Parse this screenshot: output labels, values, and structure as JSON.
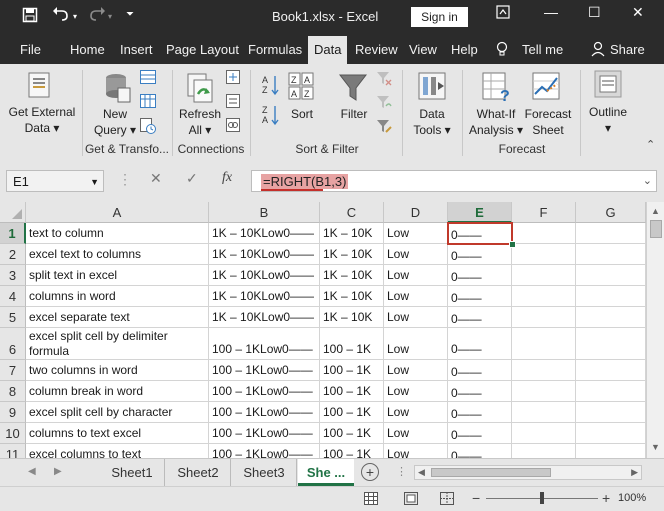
{
  "titlebar": {
    "title": "Book1.xlsx - Excel",
    "signin": "Sign in",
    "save_icon": "save-icon",
    "undo_icon": "undo-icon",
    "redo_icon": "redo-icon",
    "minimize": "—",
    "restore": "☐",
    "close": "✕",
    "ribbon_options": "▢"
  },
  "menu": {
    "items": [
      "File",
      "Home",
      "Insert",
      "Page Layout",
      "Formulas",
      "Data",
      "Review",
      "View",
      "Help",
      "Tell me",
      "Share"
    ],
    "active": "Data"
  },
  "ribbon": {
    "get_external": "Get External",
    "data_dd": "Data ▾",
    "new": "New",
    "query_dd": "Query ▾",
    "refresh": "Refresh",
    "all_dd": "All ▾",
    "sort": "Sort",
    "filter": "Filter",
    "data_label": "Data",
    "tools_dd": "Tools ▾",
    "whatif": "What-If",
    "analysis_dd": "Analysis ▾",
    "forecast": "Forecast",
    "sheet": "Sheet",
    "outline": "Outline",
    "outline_dd": "▾",
    "groups": {
      "get_transform": "Get & Transfo...",
      "connections": "Connections",
      "sort_filter": "Sort & Filter",
      "forecast": "Forecast"
    }
  },
  "formula_bar": {
    "name_box": "E1",
    "cancel": "✕",
    "enter": "✓",
    "fx": "fx",
    "formula": "=RIGHT(B1,3)"
  },
  "grid": {
    "columns": [
      "A",
      "B",
      "C",
      "D",
      "E",
      "F",
      "G"
    ],
    "selected_column": "E",
    "rows": [
      {
        "n": "1",
        "a": "text to column",
        "b": "1K – 10KLow0——",
        "c": "1K – 10K",
        "d": "Low",
        "e": "0——"
      },
      {
        "n": "2",
        "a": "excel text to columns",
        "b": "1K – 10KLow0——",
        "c": "1K – 10K",
        "d": "Low",
        "e": "0——"
      },
      {
        "n": "3",
        "a": "split text in excel",
        "b": "1K – 10KLow0——",
        "c": "1K – 10K",
        "d": "Low",
        "e": "0——"
      },
      {
        "n": "4",
        "a": "columns in word",
        "b": "1K – 10KLow0——",
        "c": "1K – 10K",
        "d": "Low",
        "e": "0——"
      },
      {
        "n": "5",
        "a": "excel separate text",
        "b": "1K – 10KLow0——",
        "c": "1K – 10K",
        "d": "Low",
        "e": "0——"
      },
      {
        "n": "6",
        "a": "excel split cell by delimiter formula",
        "b": "100 – 1KLow0——",
        "c": "100 – 1K",
        "d": "Low",
        "e": "0——"
      },
      {
        "n": "7",
        "a": "two columns in word",
        "b": "100 – 1KLow0——",
        "c": "100 – 1K",
        "d": "Low",
        "e": "0——"
      },
      {
        "n": "8",
        "a": "column break in word",
        "b": "100 – 1KLow0——",
        "c": "100 – 1K",
        "d": "Low",
        "e": "0——"
      },
      {
        "n": "9",
        "a": "excel split cell by character",
        "b": "100 – 1KLow0——",
        "c": "100 – 1K",
        "d": "Low",
        "e": "0——"
      },
      {
        "n": "10",
        "a": "columns to text excel",
        "b": "100 – 1KLow0——",
        "c": "100 – 1K",
        "d": "Low",
        "e": "0——"
      },
      {
        "n": "11",
        "a": "excel columns to text",
        "b": "100 – 1KLow0——",
        "c": "100 – 1K",
        "d": "Low",
        "e": "0——"
      }
    ]
  },
  "sheets": {
    "tabs": [
      "Sheet1",
      "Sheet2",
      "Sheet3",
      "She ..."
    ],
    "active": "She ...",
    "add": "+"
  },
  "status": {
    "zoom": "100%",
    "zoom_level": 0.5,
    "minus": "−",
    "plus": "+"
  },
  "colors": {
    "accent": "#217346",
    "titlebar": "#2b2b2b",
    "ribbon": "#e6e6e6",
    "selection_border": "#c0392b",
    "formula_highlight": "#e7a3a3"
  }
}
